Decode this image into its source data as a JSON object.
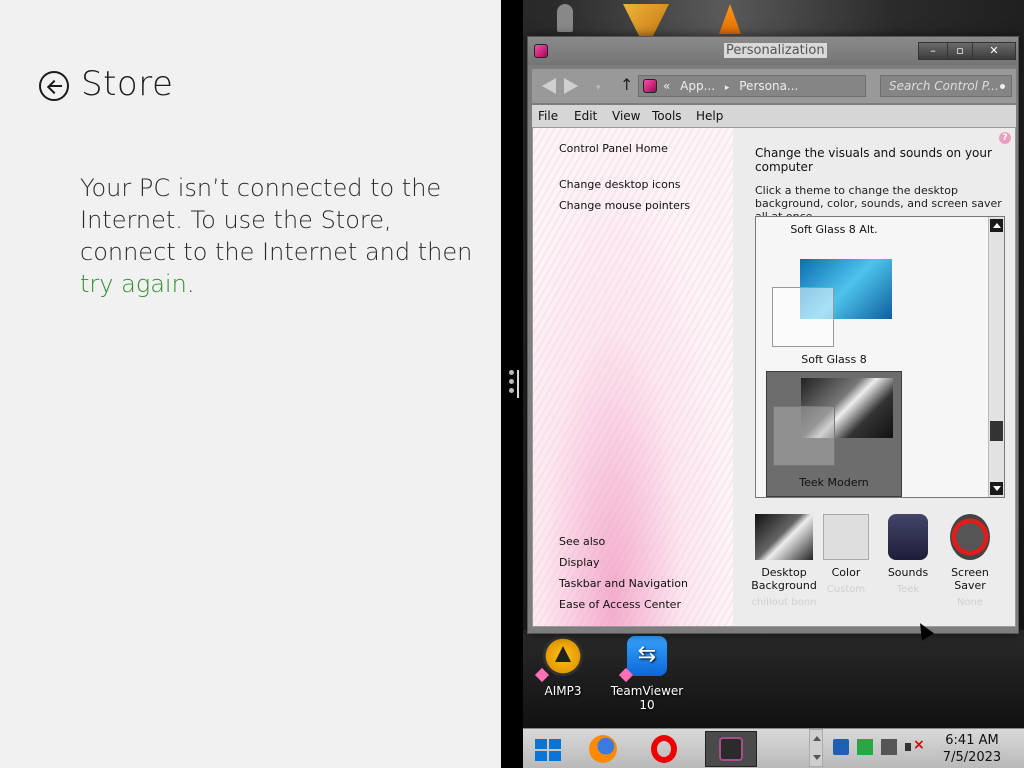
{
  "store": {
    "title": "Store",
    "message": "Your PC isn’t connected to the Internet. To use the Store, connect to the Internet and then ",
    "retry_link": "try again",
    "message_end": ".",
    "link_color": "#2f8f2f"
  },
  "window": {
    "title": "Personalization",
    "min_label": "–",
    "max_label": "▫",
    "close_label": "✕",
    "address": {
      "prefix": "«",
      "seg1": "App...",
      "sep": "▸",
      "seg2": "Persona...",
      "dropdown": "▾",
      "refresh": "↻"
    },
    "search_placeholder": "Search Control P...",
    "menu": [
      "File",
      "Edit",
      "View",
      "Tools",
      "Help"
    ],
    "left_pane": {
      "home_link": "Control Panel Home",
      "links": [
        "Change desktop icons",
        "Change mouse pointers"
      ],
      "see_also_title": "See also",
      "see_also": [
        "Display",
        "Taskbar and Navigation",
        "Ease of Access Center"
      ]
    },
    "right_pane": {
      "help": "?",
      "heading": "Change the visuals and sounds on your computer",
      "description": "Click a theme to change the desktop background, color, sounds, and screen saver all at once.",
      "themes": [
        {
          "name": "Soft Glass 8 Alt."
        },
        {
          "name": "Soft Glass 8"
        },
        {
          "name": "Teek Modern",
          "selected": true
        }
      ],
      "bottom": [
        {
          "label": "Desktop Background",
          "sub": "chillout bonn"
        },
        {
          "label": "Color",
          "sub": "Custom"
        },
        {
          "label": "Sounds",
          "sub": "Teek"
        },
        {
          "label": "Screen Saver",
          "sub": "None"
        }
      ]
    }
  },
  "desktop": {
    "icons": [
      {
        "label": "AIMP3"
      },
      {
        "label": "TeamViewer 10"
      }
    ],
    "top_icons": [
      "figure-icon",
      "vegas-icon",
      "vlc-icon"
    ]
  },
  "taskbar": {
    "time": "6:41 AM",
    "date": "7/5/2023",
    "pinned": [
      "windows-logo-icon",
      "firefox-icon",
      "opera-icon",
      "personalization-icon"
    ]
  }
}
